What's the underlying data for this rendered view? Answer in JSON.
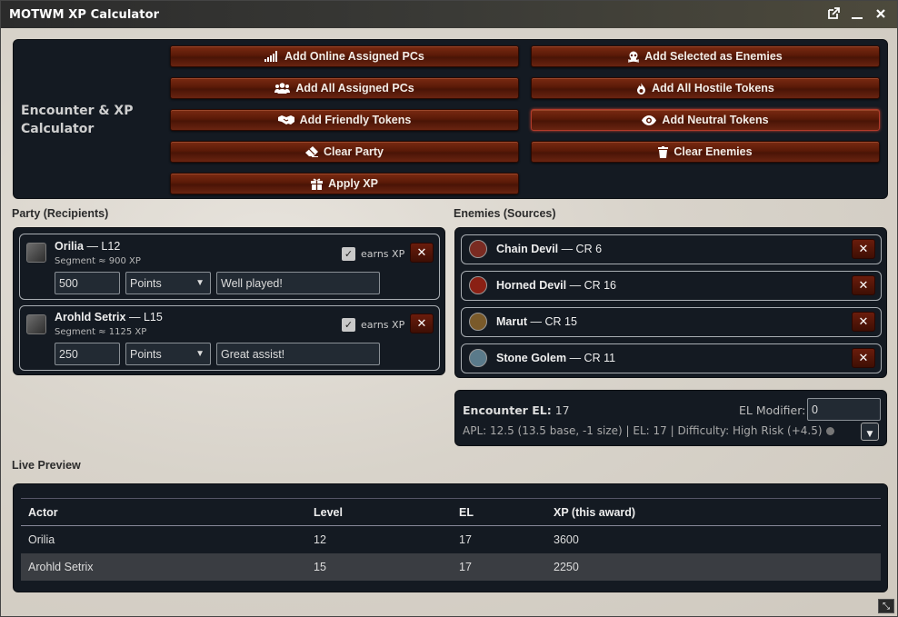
{
  "window": {
    "title": "MOTWM XP Calculator"
  },
  "actions": {
    "title": "Encounter & XP Calculator",
    "buttons": {
      "add_online": "Add Online Assigned PCs",
      "add_selected_enemies": "Add Selected as Enemies",
      "add_all_assigned": "Add All Assigned PCs",
      "add_hostile": "Add All Hostile Tokens",
      "add_friendly": "Add Friendly Tokens",
      "add_neutral": "Add Neutral Tokens",
      "clear_party": "Clear Party",
      "clear_enemies": "Clear Enemies",
      "apply_xp": "Apply XP"
    }
  },
  "party": {
    "label": "Party (Recipients)",
    "members": [
      {
        "name": "Orilia",
        "level": "— L12",
        "segment": "Segment ≈ 900 XP",
        "earns_label": "earns XP",
        "amount": "500",
        "mode": "Points",
        "note": "Well played!"
      },
      {
        "name": "Arohld Setrix",
        "level": "— L15",
        "segment": "Segment ≈ 1125 XP",
        "earns_label": "earns XP",
        "amount": "250",
        "mode": "Points",
        "note": "Great assist!"
      }
    ]
  },
  "enemies": {
    "label": "Enemies (Sources)",
    "items": [
      {
        "name": "Chain Devil",
        "cr": "— CR 6",
        "color": "#7a2b22"
      },
      {
        "name": "Horned Devil",
        "cr": "— CR 16",
        "color": "#8a2014"
      },
      {
        "name": "Marut",
        "cr": "— CR 15",
        "color": "#7a5a2a"
      },
      {
        "name": "Stone Golem",
        "cr": "— CR 11",
        "color": "#5a7a8a"
      }
    ]
  },
  "encounter": {
    "el_label": "Encounter EL:",
    "el_value": "17",
    "modifier_label": "EL Modifier:",
    "modifier_value": "0",
    "info": "APL: 12.5 (13.5 base, -1 size) | EL: 17 | Difficulty: High Risk (+4.5)"
  },
  "preview": {
    "label": "Live Preview",
    "columns": [
      "Actor",
      "Level",
      "EL",
      "XP (this award)"
    ],
    "rows": [
      [
        "Orilia",
        "12",
        "17",
        "3600"
      ],
      [
        "Arohld Setrix",
        "15",
        "17",
        "2250"
      ]
    ]
  }
}
